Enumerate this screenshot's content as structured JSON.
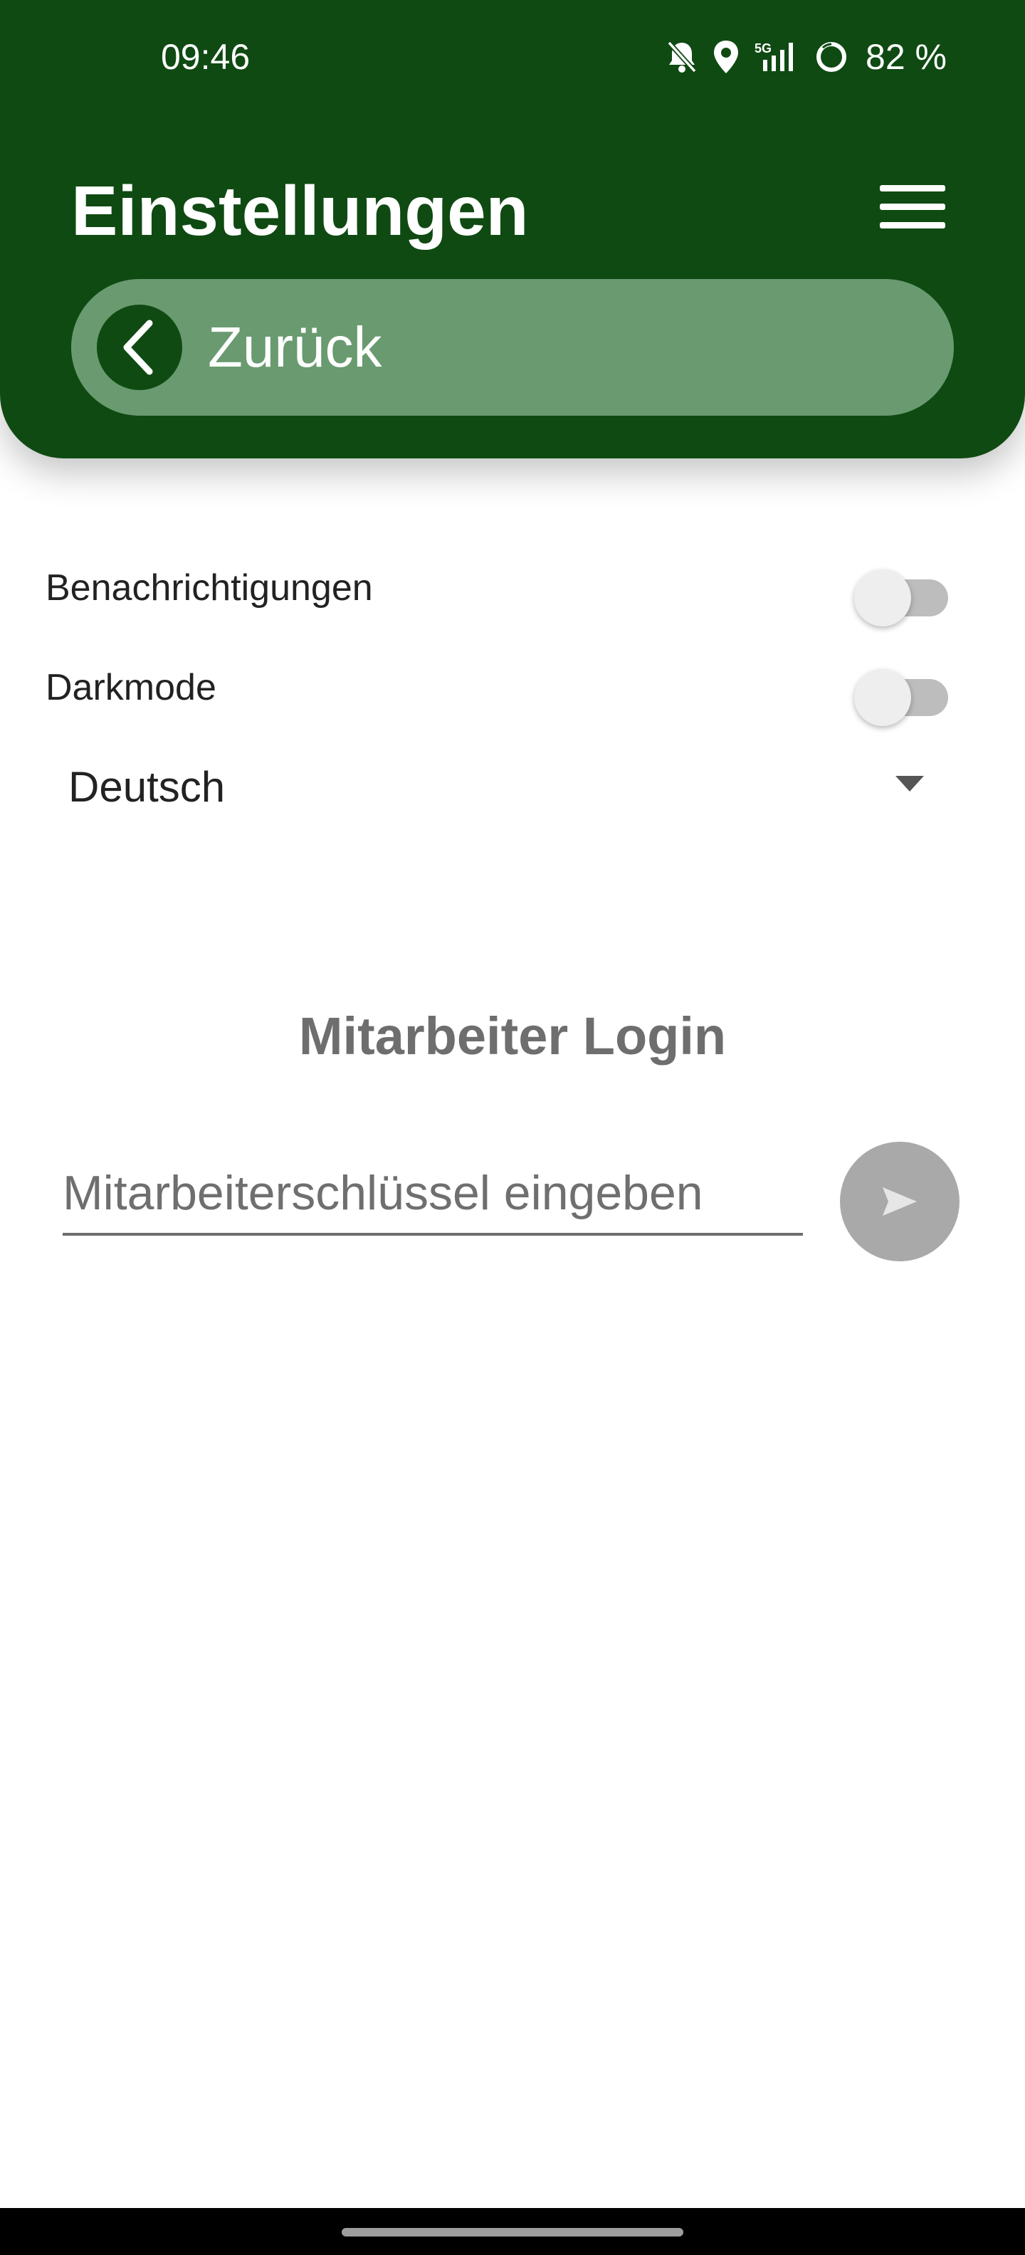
{
  "status_bar": {
    "time": "09:46",
    "network": "5G",
    "battery": "82 %",
    "icons": [
      "bell-off-icon",
      "location-pin-icon",
      "5g-signal-icon",
      "battery-ring-icon"
    ]
  },
  "header": {
    "title": "Einstellungen",
    "menu_icon": "hamburger-menu-icon",
    "back_label": "Zurück",
    "back_icon": "chevron-left-icon"
  },
  "settings": {
    "items": [
      {
        "label": "Benachrichtigungen",
        "enabled": false
      },
      {
        "label": "Darkmode",
        "enabled": false
      }
    ],
    "language": {
      "selected": "Deutsch"
    }
  },
  "login": {
    "title": "Mitarbeiter Login",
    "key_placeholder": "Mitarbeiterschlüssel eingeben",
    "key_value": "",
    "send_icon": "send-icon"
  },
  "colors": {
    "header_bg": "#0f4a12",
    "back_bar_bg": "#6a9a6f",
    "send_button_bg": "#a9a9a9",
    "text_muted": "#6e6e6e"
  }
}
